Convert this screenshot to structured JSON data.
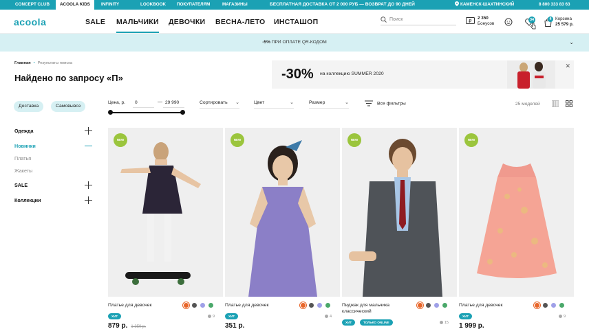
{
  "topbar": {
    "concept_club": "CONCEPT CLUB",
    "acoola_kids": "ACOOLA KIDS",
    "infinity": "INFINITY",
    "lookbook": "LOOKBOOK",
    "buyers": "ПОКУПАТЕЛЯМ",
    "stores": "МАГАЗИНЫ",
    "promo": "БЕСПЛАТНАЯ ДОСТАВКА ОТ 2 000 РУБ — ВОЗВРАТ ДО 90 ДНЕЙ",
    "city": "КАМЕНСК-ШАХТИНСКИЙ",
    "phone": "8 800 333 83 63"
  },
  "header": {
    "logo": "acoola",
    "nav": [
      "SALE",
      "МАЛЬЧИКИ",
      "ДЕВОЧКИ",
      "ВЕСНА-ЛЕТО",
      "ИНСТАШОП"
    ],
    "active_nav": "МАЛЬЧИКИ",
    "search_placeholder": "Поиск",
    "bonus_value": "2 350",
    "bonus_label": "Бонусов",
    "favorites_count": "34",
    "cart_count": "4",
    "cart_label": "Корзина",
    "cart_total": "25 579 р."
  },
  "qr_banner": {
    "discount": "-5%",
    "text": " ПРИ ОПЛАТЕ QR-КОДОМ"
  },
  "breadcrumb": {
    "home": "Главная",
    "current": "Результаты поиска"
  },
  "page_title": "Найдено по запросу «П»",
  "promo_banner": {
    "percent": "-30%",
    "text": "на коллекцию SUMMER 2020"
  },
  "filters": {
    "delivery": "Доставка",
    "pickup": "Самовывоз",
    "price_label": "Цена, р.",
    "price_min": "0",
    "price_max": "29 990",
    "price_min_fraction": 0.0,
    "price_max_fraction": 1.0,
    "sort": "Сортировать",
    "color": "Цвет",
    "size": "Размер",
    "all_filters": "Все фильтры",
    "models_count": "25 моделей"
  },
  "sidebar": {
    "clothes": "Одежда",
    "news": "Новинки",
    "dresses": "Платья",
    "jackets": "Жакеты",
    "sale": "SALE",
    "collections": "Коллекции"
  },
  "products": [
    {
      "name": "Платье для девочек",
      "badge": "NEW",
      "tags": [
        "ХИТ"
      ],
      "price": "879 р.",
      "old_price": "1 350 р.",
      "reviews": "9",
      "swatches": [
        "#e8662a",
        "#555555",
        "#9fa0e8",
        "#4aa86a"
      ]
    },
    {
      "name": "Платье для девочек",
      "badge": "NEW",
      "tags": [
        "ХИТ"
      ],
      "price": "351 р.",
      "old_price": "",
      "reviews": "4",
      "swatches": [
        "#e8662a",
        "#555555",
        "#9fa0e8",
        "#4aa86a"
      ]
    },
    {
      "name": "Пиджак для мальчика классический",
      "badge": "NEW",
      "tags": [
        "ХИТ",
        "ТОЛЬКО ONLINE"
      ],
      "price": "",
      "old_price": "",
      "reviews": "15",
      "swatches": [
        "#e8662a",
        "#555555",
        "#9fa0e8",
        "#4aa86a"
      ]
    },
    {
      "name": "Платье для девочек",
      "badge": "NEW",
      "tags": [
        "ХИТ"
      ],
      "price": "1 999 р.",
      "old_price": "",
      "reviews": "9",
      "swatches": [
        "#e8662a",
        "#555555",
        "#9fa0e8",
        "#4aa86a"
      ]
    }
  ],
  "colors": {
    "accent": "#1ba1b4",
    "accent_light": "#d6f0f3",
    "new_badge": "#9bc53d"
  }
}
